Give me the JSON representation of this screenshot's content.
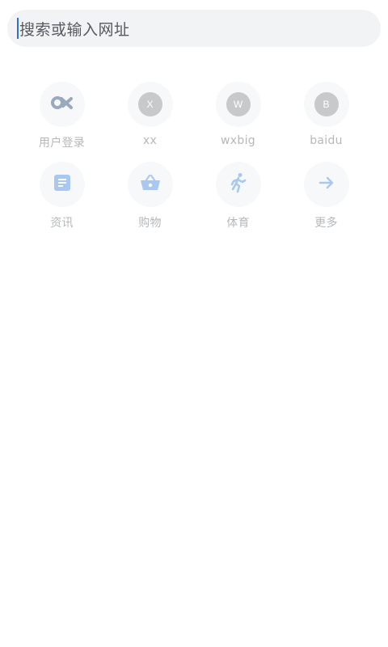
{
  "search": {
    "placeholder": "搜索或输入网址"
  },
  "shortcuts": [
    {
      "label": "用户登录",
      "icon": "infinity-logo-icon"
    },
    {
      "label": "xx",
      "icon": "letter-x-icon",
      "letter": "X"
    },
    {
      "label": "wxbig",
      "icon": "letter-w-icon",
      "letter": "W"
    },
    {
      "label": "baidu",
      "icon": "letter-b-icon",
      "letter": "B"
    },
    {
      "label": "资讯",
      "icon": "news-icon"
    },
    {
      "label": "购物",
      "icon": "shopping-basket-icon"
    },
    {
      "label": "体育",
      "icon": "running-person-icon"
    },
    {
      "label": "更多",
      "icon": "arrow-right-icon"
    }
  ],
  "colors": {
    "search_bg": "#f2f3f5",
    "caret": "#2f6fd1",
    "icon_blue": "#a9c8f0",
    "badge_grey": "#c8c9cb"
  }
}
